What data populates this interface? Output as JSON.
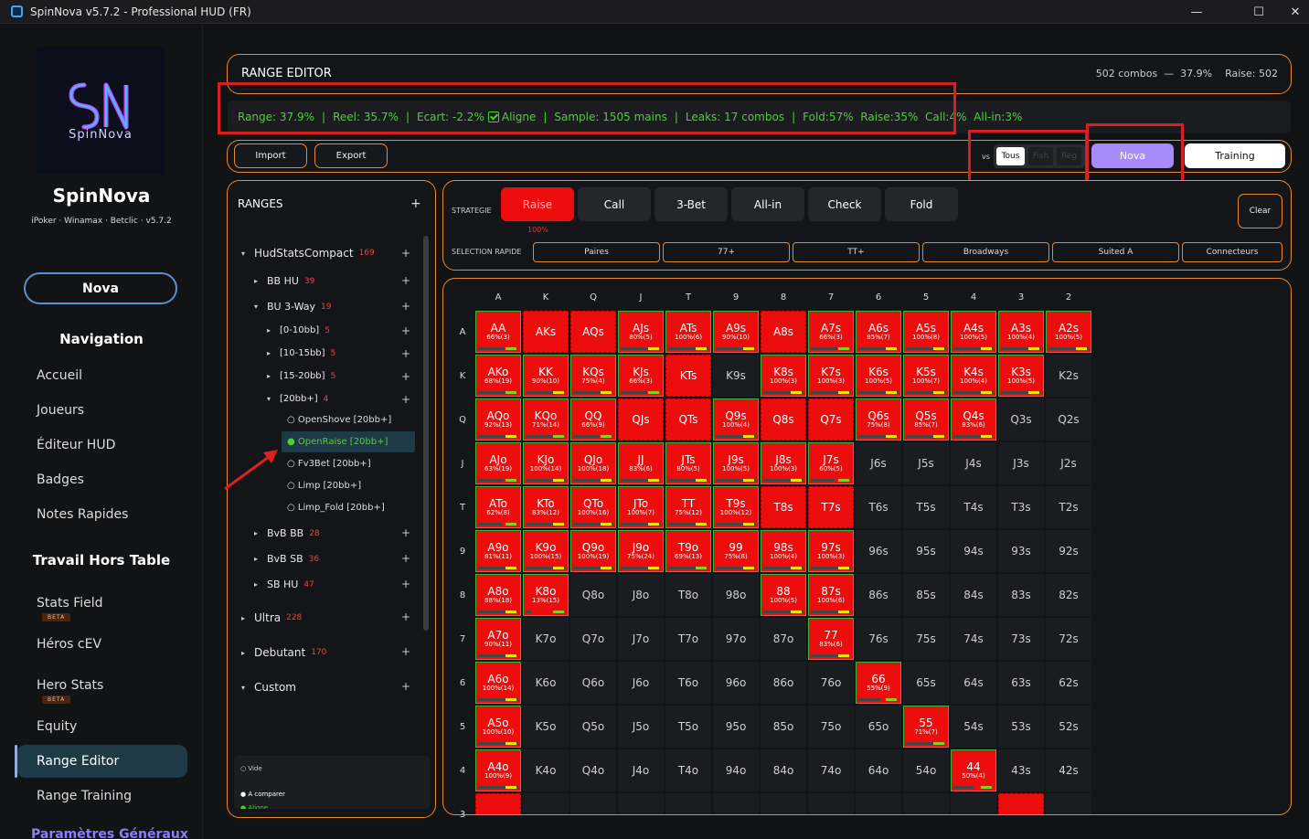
{
  "window": {
    "title": "SpinNova v5.7.2 - Professional HUD (FR)",
    "min": "—",
    "max": "☐",
    "close": "✕"
  },
  "sidebar": {
    "logo_text": "SpinNova",
    "brand": "SpinNova",
    "brand_sub": "iPoker · Winamax · Betclic  ·  v5.7.2",
    "nova_button": "Nova",
    "navigation_heading": "Navigation",
    "nav": [
      "Accueil",
      "Joueurs",
      "Éditeur HUD",
      "Badges",
      "Notes Rapides"
    ],
    "offtable_heading": "Travail Hors Table",
    "offtable": [
      "Stats Field",
      "Héros cEV",
      "Hero Stats",
      "Equity",
      "Range Editor",
      "Range Training"
    ],
    "beta_label": "BETA",
    "settings": "Paramètres Généraux"
  },
  "header": {
    "title": "RANGE EDITOR",
    "summary": "502 combos  —  37.9%    Raise: 502"
  },
  "stats": {
    "range": "Range: 37.9%",
    "reel": "Reel: 35.7%",
    "ecart": "Ecart: -2.2%",
    "aligne": "Aligne",
    "sample": "Sample: 1505 mains",
    "leaks": "Leaks: 17 combos",
    "fold": "Fold:57%",
    "raise": "Raise:35%",
    "call": "Call:4%",
    "allin": "All-in:3%"
  },
  "toolbar": {
    "import": "Import",
    "export": "Export",
    "vs": "vs",
    "vs_tous": "Tous",
    "vs_fish": "Fish",
    "vs_reg": "Reg",
    "nova": "Nova",
    "training": "Training"
  },
  "ranges": {
    "title": "RANGES",
    "add": "+",
    "tree": [
      {
        "label": "HudStatsCompact",
        "count": "169"
      },
      {
        "label": "BB HU",
        "count": "39"
      },
      {
        "label": "BU 3-Way",
        "count": "19"
      },
      {
        "label": "[0-10bb]",
        "count": "5"
      },
      {
        "label": "[10-15bb]",
        "count": "5"
      },
      {
        "label": "[15-20bb]",
        "count": "5"
      },
      {
        "label": "[20bb+]",
        "count": "4"
      },
      {
        "label": "BvB BB",
        "count": "28"
      },
      {
        "label": "BvB SB",
        "count": "36"
      },
      {
        "label": "SB HU",
        "count": "47"
      },
      {
        "label": "Ultra",
        "count": "228"
      },
      {
        "label": "Debutant",
        "count": "170"
      },
      {
        "label": "Custom",
        "count": ""
      }
    ],
    "leaves": [
      "○ OpenShove [20bb+]",
      "● OpenRaise [20bb+]",
      "○ Fv3Bet [20bb+]",
      "○ Limp [20bb+]",
      "○ Limp_Fold [20bb+]"
    ],
    "legend": [
      "○ Vide",
      "● A comparer",
      "● Aligne"
    ]
  },
  "strategy": {
    "label": "STRATEGIE",
    "quick_label": "SELECTION RAPIDE",
    "buttons": [
      "Raise",
      "Call",
      "3-Bet",
      "All-in",
      "Check",
      "Fold"
    ],
    "raise_pct": "100%",
    "clear": "Clear",
    "quick": [
      "Paires",
      "77+",
      "TT+",
      "Broadways",
      "Suited A",
      "Connecteurs"
    ]
  },
  "matrix": {
    "ranks": [
      "A",
      "K",
      "Q",
      "J",
      "T",
      "9",
      "8",
      "7",
      "6",
      "5",
      "4",
      "3",
      "2"
    ],
    "rows": [
      [
        [
          "AA",
          "66%(3)"
        ],
        [
          "AKs",
          ""
        ],
        [
          "AQs",
          ""
        ],
        [
          "AJs",
          "80%(5)"
        ],
        [
          "ATs",
          "100%(6)"
        ],
        [
          "A9s",
          "90%(10)"
        ],
        [
          "A8s",
          ""
        ],
        [
          "A7s",
          "66%(3)"
        ],
        [
          "A6s",
          "85%(7)"
        ],
        [
          "A5s",
          "100%(8)"
        ],
        [
          "A4s",
          "100%(5)"
        ],
        [
          "A3s",
          "100%(4)"
        ],
        [
          "A2s",
          "100%(5)"
        ]
      ],
      [
        [
          "AKo",
          "68%(19)"
        ],
        [
          "KK",
          "90%(10)"
        ],
        [
          "KQs",
          "75%(4)"
        ],
        [
          "KJs",
          "66%(3)"
        ],
        [
          "KTs",
          ""
        ],
        [
          "K9s",
          ""
        ],
        [
          "K8s",
          "100%(3)"
        ],
        [
          "K7s",
          "100%(3)"
        ],
        [
          "K6s",
          "100%(5)"
        ],
        [
          "K5s",
          "100%(7)"
        ],
        [
          "K4s",
          "100%(4)"
        ],
        [
          "K3s",
          "100%(5)"
        ],
        [
          "K2s",
          ""
        ]
      ],
      [
        [
          "AQo",
          "92%(13)"
        ],
        [
          "KQo",
          "71%(14)"
        ],
        [
          "QQ",
          "66%(9)"
        ],
        [
          "QJs",
          ""
        ],
        [
          "QTs",
          ""
        ],
        [
          "Q9s",
          "100%(4)"
        ],
        [
          "Q8s",
          ""
        ],
        [
          "Q7s",
          ""
        ],
        [
          "Q6s",
          "75%(8)"
        ],
        [
          "Q5s",
          "85%(7)"
        ],
        [
          "Q4s",
          "83%(6)"
        ],
        [
          "Q3s",
          ""
        ],
        [
          "Q2s",
          ""
        ]
      ],
      [
        [
          "AJo",
          "63%(19)"
        ],
        [
          "KJo",
          "100%(14)"
        ],
        [
          "QJo",
          "100%(18)"
        ],
        [
          "JJ",
          "83%(6)"
        ],
        [
          "JTs",
          "80%(5)"
        ],
        [
          "J9s",
          "100%(5)"
        ],
        [
          "J8s",
          "100%(3)"
        ],
        [
          "J7s",
          "60%(5)"
        ],
        [
          "J6s",
          ""
        ],
        [
          "J5s",
          ""
        ],
        [
          "J4s",
          ""
        ],
        [
          "J3s",
          ""
        ],
        [
          "J2s",
          ""
        ]
      ],
      [
        [
          "ATo",
          "62%(8)"
        ],
        [
          "KTo",
          "83%(12)"
        ],
        [
          "QTo",
          "100%(16)"
        ],
        [
          "JTo",
          "100%(7)"
        ],
        [
          "TT",
          "75%(12)"
        ],
        [
          "T9s",
          "100%(12)"
        ],
        [
          "T8s",
          ""
        ],
        [
          "T7s",
          ""
        ],
        [
          "T6s",
          ""
        ],
        [
          "T5s",
          ""
        ],
        [
          "T4s",
          ""
        ],
        [
          "T3s",
          ""
        ],
        [
          "T2s",
          ""
        ]
      ],
      [
        [
          "A9o",
          "81%(11)"
        ],
        [
          "K9o",
          "100%(15)"
        ],
        [
          "Q9o",
          "100%(19)"
        ],
        [
          "J9o",
          "75%(24)"
        ],
        [
          "T9o",
          "69%(13)"
        ],
        [
          "99",
          "75%(8)"
        ],
        [
          "98s",
          "100%(4)"
        ],
        [
          "97s",
          "100%(3)"
        ],
        [
          "96s",
          ""
        ],
        [
          "95s",
          ""
        ],
        [
          "94s",
          ""
        ],
        [
          "93s",
          ""
        ],
        [
          "92s",
          ""
        ]
      ],
      [
        [
          "A8o",
          "88%(18)"
        ],
        [
          "K8o",
          "13%(15)"
        ],
        [
          "Q8o",
          ""
        ],
        [
          "J8o",
          ""
        ],
        [
          "T8o",
          ""
        ],
        [
          "98o",
          ""
        ],
        [
          "88",
          "100%(5)"
        ],
        [
          "87s",
          "100%(6)"
        ],
        [
          "86s",
          ""
        ],
        [
          "85s",
          ""
        ],
        [
          "84s",
          ""
        ],
        [
          "83s",
          ""
        ],
        [
          "82s",
          ""
        ]
      ],
      [
        [
          "A7o",
          "90%(11)"
        ],
        [
          "K7o",
          ""
        ],
        [
          "Q7o",
          ""
        ],
        [
          "J7o",
          ""
        ],
        [
          "T7o",
          ""
        ],
        [
          "97o",
          ""
        ],
        [
          "87o",
          ""
        ],
        [
          "77",
          "83%(6)"
        ],
        [
          "76s",
          ""
        ],
        [
          "75s",
          ""
        ],
        [
          "74s",
          ""
        ],
        [
          "73s",
          ""
        ],
        [
          "72s",
          ""
        ]
      ],
      [
        [
          "A6o",
          "100%(14)"
        ],
        [
          "K6o",
          ""
        ],
        [
          "Q6o",
          ""
        ],
        [
          "J6o",
          ""
        ],
        [
          "T6o",
          ""
        ],
        [
          "96o",
          ""
        ],
        [
          "86o",
          ""
        ],
        [
          "76o",
          ""
        ],
        [
          "66",
          "55%(9)"
        ],
        [
          "65s",
          ""
        ],
        [
          "64s",
          ""
        ],
        [
          "63s",
          ""
        ],
        [
          "62s",
          ""
        ]
      ],
      [
        [
          "A5o",
          "100%(10)"
        ],
        [
          "K5o",
          ""
        ],
        [
          "Q5o",
          ""
        ],
        [
          "J5o",
          ""
        ],
        [
          "T5o",
          ""
        ],
        [
          "95o",
          ""
        ],
        [
          "85o",
          ""
        ],
        [
          "75o",
          ""
        ],
        [
          "65o",
          ""
        ],
        [
          "55",
          "71%(7)"
        ],
        [
          "54s",
          ""
        ],
        [
          "53s",
          ""
        ],
        [
          "52s",
          ""
        ]
      ],
      [
        [
          "A4o",
          "100%(9)"
        ],
        [
          "K4o",
          ""
        ],
        [
          "Q4o",
          ""
        ],
        [
          "J4o",
          ""
        ],
        [
          "T4o",
          ""
        ],
        [
          "94o",
          ""
        ],
        [
          "84o",
          ""
        ],
        [
          "74o",
          ""
        ],
        [
          "64o",
          ""
        ],
        [
          "54o",
          ""
        ],
        [
          "44",
          "50%(4)"
        ],
        [
          "43s",
          ""
        ],
        [
          "42s",
          ""
        ]
      ],
      [
        [
          "",
          ""
        ],
        [
          "",
          ""
        ],
        [
          "",
          ""
        ],
        [
          "",
          ""
        ],
        [
          "",
          ""
        ],
        [
          "",
          ""
        ],
        [
          "",
          ""
        ],
        [
          "",
          ""
        ],
        [
          "",
          ""
        ],
        [
          "",
          ""
        ],
        [
          "",
          ""
        ],
        [
          "",
          ""
        ],
        [
          "",
          ""
        ]
      ]
    ],
    "selected": [
      [
        1,
        1,
        1,
        1,
        1,
        1,
        1,
        1,
        1,
        1,
        1,
        1,
        1
      ],
      [
        1,
        1,
        1,
        1,
        1,
        0,
        1,
        1,
        1,
        1,
        1,
        1,
        0
      ],
      [
        1,
        1,
        1,
        1,
        1,
        1,
        1,
        1,
        1,
        1,
        1,
        0,
        0
      ],
      [
        1,
        1,
        1,
        1,
        1,
        1,
        1,
        1,
        0,
        0,
        0,
        0,
        0
      ],
      [
        1,
        1,
        1,
        1,
        1,
        1,
        1,
        1,
        0,
        0,
        0,
        0,
        0
      ],
      [
        1,
        1,
        1,
        1,
        1,
        1,
        1,
        1,
        0,
        0,
        0,
        0,
        0
      ],
      [
        1,
        1,
        0,
        0,
        0,
        0,
        1,
        1,
        0,
        0,
        0,
        0,
        0
      ],
      [
        1,
        0,
        0,
        0,
        0,
        0,
        0,
        1,
        0,
        0,
        0,
        0,
        0
      ],
      [
        1,
        0,
        0,
        0,
        0,
        0,
        0,
        0,
        1,
        0,
        0,
        0,
        0
      ],
      [
        1,
        0,
        0,
        0,
        0,
        0,
        0,
        0,
        0,
        1,
        0,
        0,
        0
      ],
      [
        1,
        0,
        0,
        0,
        0,
        0,
        0,
        0,
        0,
        0,
        1,
        0,
        0
      ],
      [
        1,
        0,
        0,
        0,
        0,
        0,
        0,
        0,
        0,
        0,
        0,
        1,
        0
      ]
    ]
  },
  "colors": {
    "accent": "#e8892e",
    "raise": "#ee0d0d",
    "green": "#4cd137",
    "nova": "#a78bfa",
    "active": "#1f3a47"
  }
}
